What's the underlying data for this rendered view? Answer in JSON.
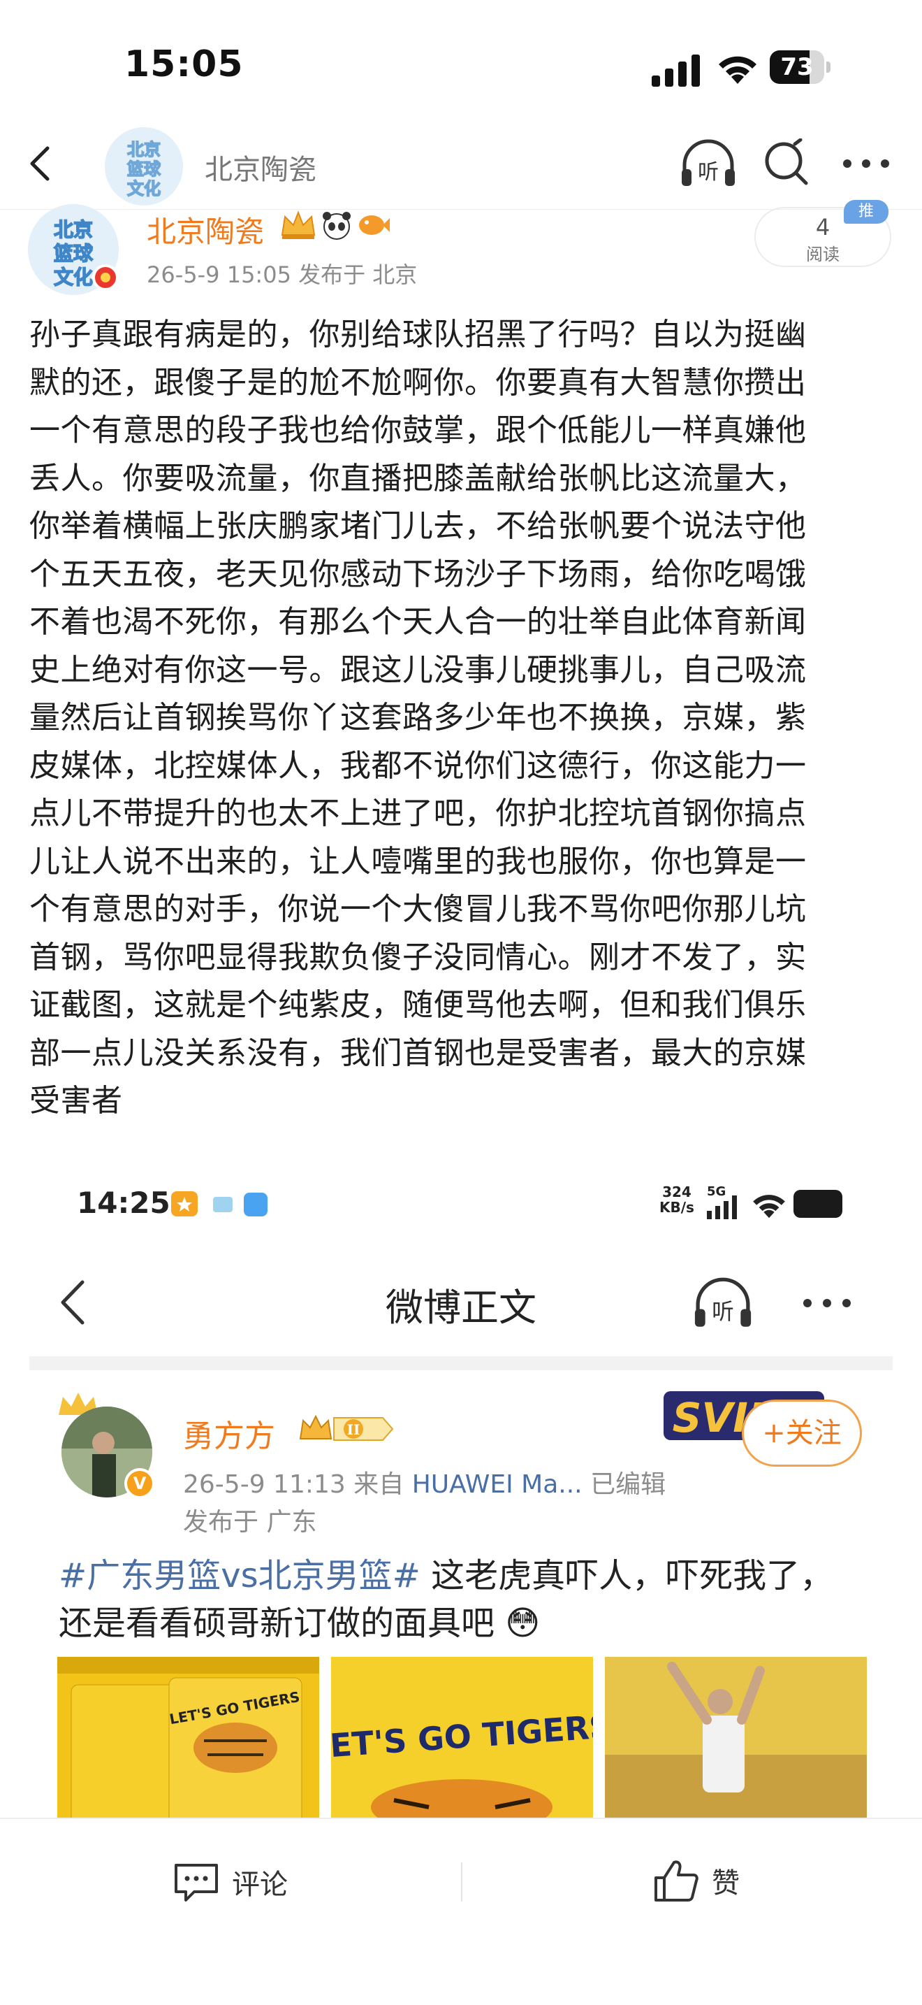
{
  "status_bar": {
    "time": "15:05",
    "battery": "73",
    "battery_fraction": 0.73
  },
  "nav": {
    "title": "北京陶瓷",
    "avatar_text": "北京篮球文化"
  },
  "post": {
    "author": "北京陶瓷",
    "avatar_text": "北京篮球文化",
    "meta": "26-5-9 15:05  发布于 北京",
    "read_count": "4",
    "read_label": "阅读",
    "promo_tag": "推",
    "lines": [
      "孙子真跟有病是的，你别给球队招黑了行吗？自以为挺幽",
      "默的还，跟傻子是的尬不尬啊你。你要真有大智慧你攒出",
      "一个有意思的段子我也给你鼓掌，跟个低能儿一样真嫌他",
      "丢人。你要吸流量，你直播把膝盖献给张帆比这流量大，",
      "你举着横幅上张庆鹏家堵门儿去，不给张帆要个说法守他",
      "个五天五夜，老天见你感动下场沙子下场雨，给你吃喝饿",
      "不着也渴不死你，有那么个天人合一的壮举自此体育新闻",
      "史上绝对有你这一号。跟这儿没事儿硬挑事儿，自己吸流",
      "量然后让首钢挨骂你丫这套路多少年也不换换，京媒，紫",
      "皮媒体，北控媒体人，我都不说你们这德行，你这能力一",
      "点儿不带提升的也太不上进了吧，你护北控坑首钢你搞点",
      "儿让人说不出来的，让人噎嘴里的我也服你，你也算是一",
      "个有意思的对手，你说一个大傻冒儿我不骂你吧你那儿坑",
      "首钢，骂你吧显得我欺负傻子没同情心。刚才不发了，实",
      "证截图，这就是个纯紫皮，随便骂他去啊，但和我们俱乐",
      "部一点儿没关系没有，我们首钢也是受害者，最大的京媒",
      "受害者"
    ]
  },
  "embedded": {
    "time": "14:25",
    "net_speed_value": "324",
    "net_speed_unit": "KB/s",
    "network": "5G",
    "title": "微博正文",
    "listen_label": "听",
    "author": "勇方方",
    "level": "II",
    "meta_time": "26-5-9 11:13  来自 ",
    "meta_device": "HUAWEI Ma...",
    "meta_edited": "  已编辑",
    "meta_location": "发布于 广东",
    "svip": "SVIP",
    "follow_label": "+关注",
    "hashtag": "#广东男篮vs北京男篮#",
    "text_after_tag": " 这老虎真吓人，吓死我了，",
    "text_line2": "还是看看硕哥新订做的面具吧",
    "photo_captions": [
      "LET'S GO TIGERS",
      "LET'S GO TIGERS"
    ]
  },
  "nav_listen_label": "听",
  "bottom_bar": {
    "comment_label": "评论",
    "like_label": "赞"
  },
  "colors": {
    "accent_orange": "#f07a1c",
    "link_blue": "#4a6fa5",
    "meta_gray": "#8c8c8c"
  }
}
